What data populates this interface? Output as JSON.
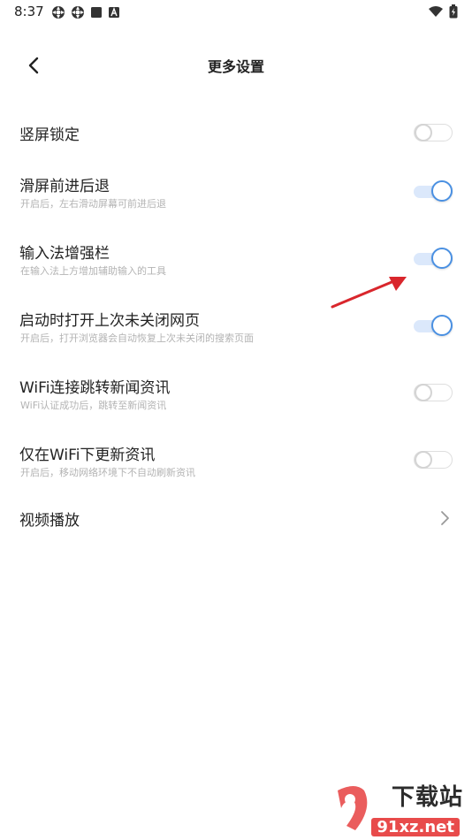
{
  "status_bar": {
    "time": "8:37",
    "left_icons": [
      "settings-gear-icon",
      "settings-gear-icon",
      "square-icon",
      "app-a-icon"
    ],
    "right_icons": [
      "wifi-icon",
      "battery-icon"
    ]
  },
  "header": {
    "title": "更多设置",
    "back_icon": "chevron-left-icon"
  },
  "settings": [
    {
      "title": "竖屏锁定",
      "subtitle": "",
      "control": "toggle",
      "on": false
    },
    {
      "title": "滑屏前进后退",
      "subtitle": "开启后，左右滑动屏幕可前进后退",
      "control": "toggle",
      "on": true
    },
    {
      "title": "输入法增强栏",
      "subtitle": "在输入法上方增加辅助输入的工具",
      "control": "toggle",
      "on": true
    },
    {
      "title": "启动时打开上次未关闭网页",
      "subtitle": "开启后，打开浏览器会自动恢复上次未关闭的搜索页面",
      "control": "toggle",
      "on": true
    },
    {
      "title": "WiFi连接跳转新闻资讯",
      "subtitle": "WiFi认证成功后，跳转至新闻资讯",
      "control": "toggle",
      "on": false
    },
    {
      "title": "仅在WiFi下更新资讯",
      "subtitle": "开启后，移动网络环境下不自动刷新资讯",
      "control": "toggle",
      "on": false
    },
    {
      "title": "视频播放",
      "subtitle": "",
      "control": "chevron",
      "on": false
    }
  ],
  "colors": {
    "accent": "#4a90e2",
    "track_on": "#dbe8fb",
    "annotation_arrow": "#d9262c"
  },
  "watermark": {
    "text": "下载站",
    "url": "91xz.net"
  }
}
